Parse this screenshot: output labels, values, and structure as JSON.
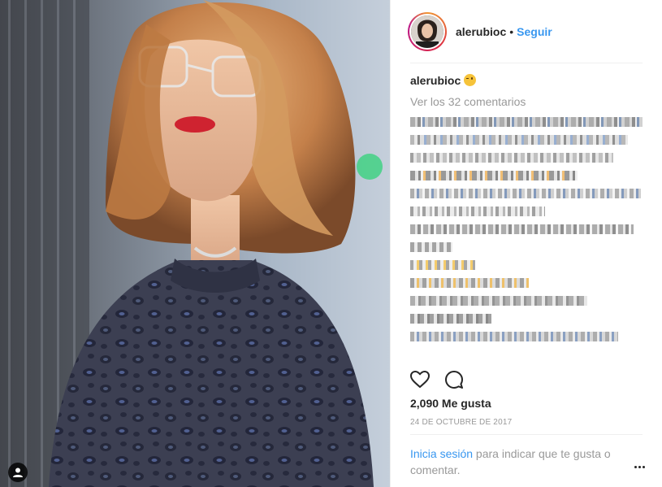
{
  "post": {
    "username": "alerubioc",
    "separator": "•",
    "follow_label": "Seguir",
    "caption_user": "alerubioc",
    "caption_emoji": "wink-face-emoji",
    "view_comments": "Ver los 32 comentarios",
    "likes": "2,090 Me gusta",
    "date": "24 DE OCTUBRE DE 2017",
    "login_link": "Inicia sesión",
    "login_text": " para indicar que te gusta o comentar."
  },
  "icons": {
    "like": "heart-icon",
    "comment": "comment-icon",
    "more": "more-options-icon",
    "tag": "user-tag-icon"
  },
  "colors": {
    "link": "#3897f0",
    "muted": "#999999",
    "text": "#262626",
    "border": "#efefef"
  }
}
